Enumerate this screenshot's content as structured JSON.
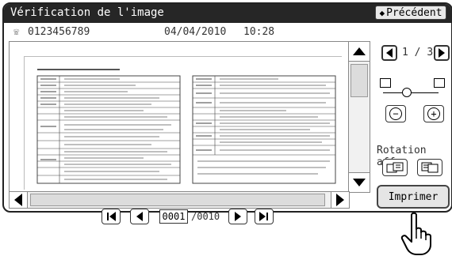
{
  "window": {
    "title": "Vérification de l'image",
    "back_button": "Précédent"
  },
  "info": {
    "phone": "0123456789",
    "date": "04/04/2010",
    "time": "10:28"
  },
  "pager": {
    "current": "1",
    "separator": "/",
    "total": "3"
  },
  "zoom": {
    "minus_label": "−",
    "plus_label": "+"
  },
  "rotation": {
    "label": "Rotation aff."
  },
  "bottom_nav": {
    "page_value": "0001",
    "page_total": "/0010"
  },
  "print_button": "Imprimer",
  "icons": [
    "phone-icon",
    "back-arrow-icon",
    "scroll-up-icon",
    "scroll-down-icon",
    "scroll-left-icon",
    "scroll-right-icon",
    "page-prev-icon",
    "page-next-icon",
    "zoom-minus-icon",
    "zoom-plus-icon",
    "rotate-left-icon",
    "rotate-right-icon",
    "first-page-icon",
    "last-page-icon",
    "hand-pointer-icon"
  ],
  "colors": {
    "titlebar": "#262626",
    "button_bg": "#e9e9e9"
  }
}
